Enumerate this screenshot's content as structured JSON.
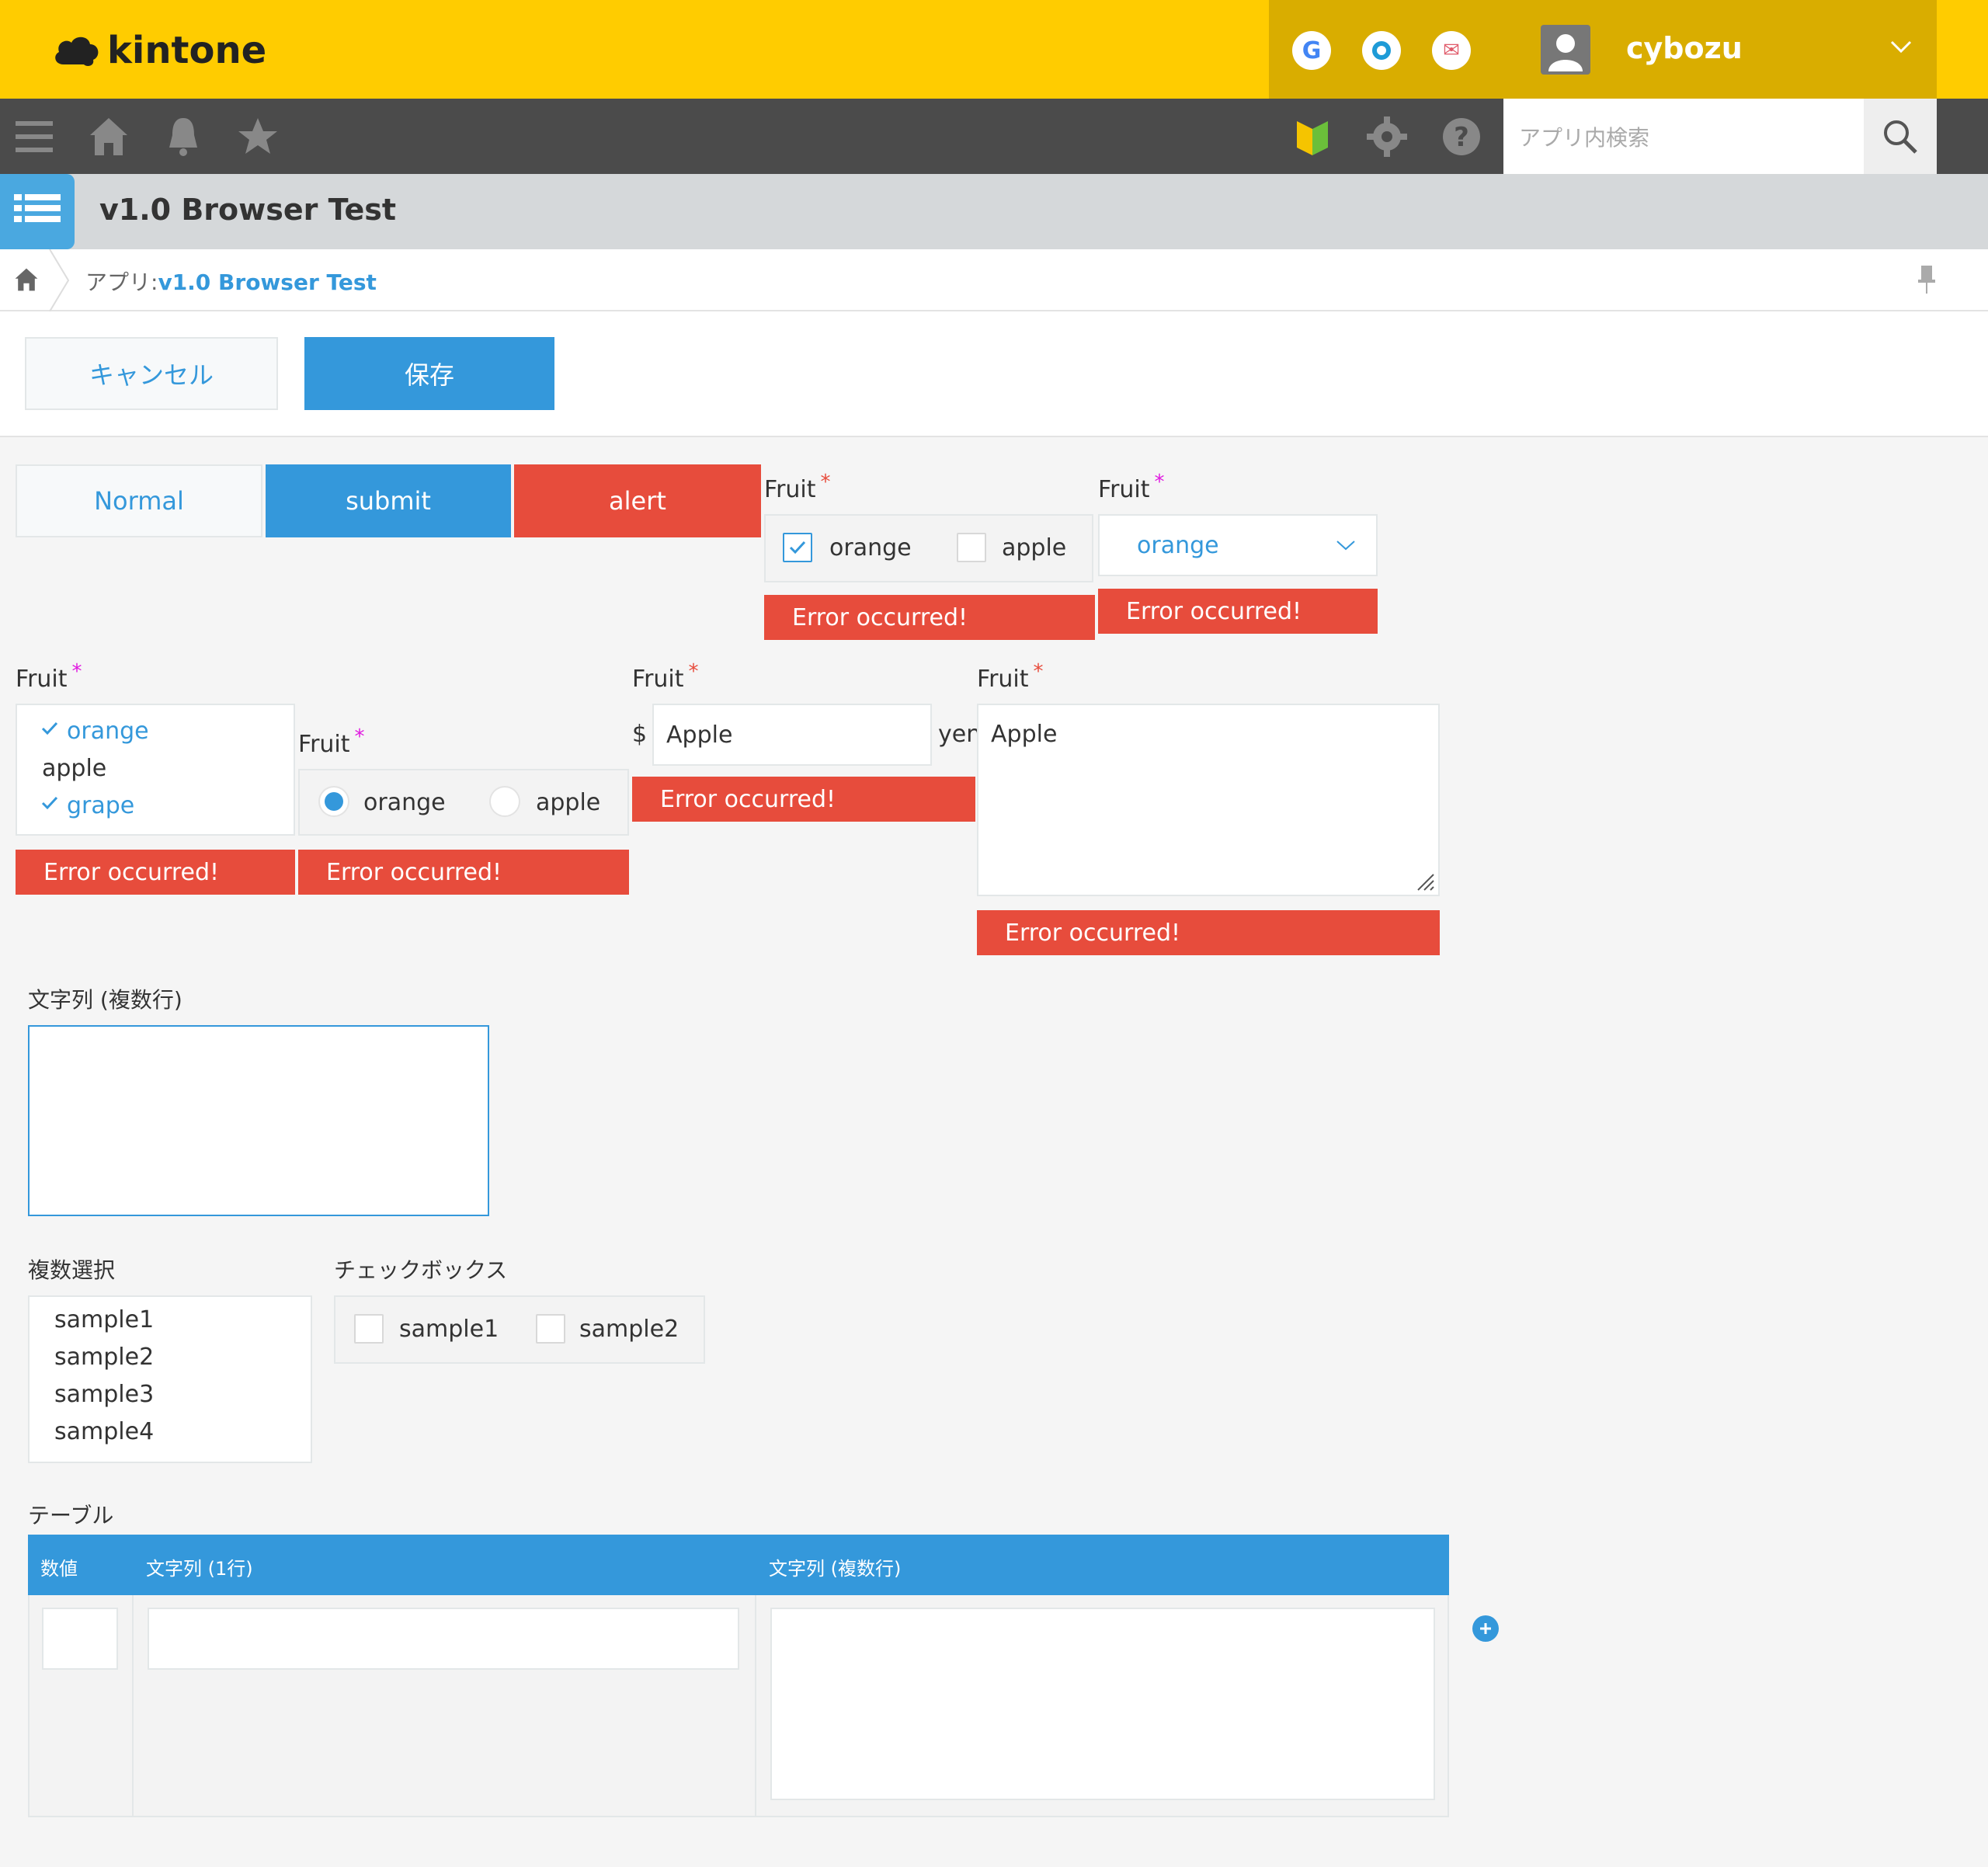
{
  "header": {
    "logo_text": "kintone",
    "apps": [
      {
        "name": "google-app",
        "glyph": "G",
        "color": "#4285f4"
      },
      {
        "name": "outlook-app",
        "glyph": "o",
        "color": "#1e9bd7"
      },
      {
        "name": "mail-app",
        "glyph": "✉",
        "color": "#e05a6a"
      }
    ],
    "username": "cybozu"
  },
  "nav": {
    "search_placeholder": "アプリ内検索"
  },
  "app": {
    "title": "v1.0 Browser Test",
    "breadcrumb_prefix": "アプリ:",
    "breadcrumb_app": "v1.0 Browser Test"
  },
  "actions": {
    "cancel": "キャンセル",
    "save": "保存"
  },
  "buttons": {
    "normal": "Normal",
    "submit": "submit",
    "alert": "alert"
  },
  "fields": {
    "label_fruit": "Fruit",
    "required_mark": "*",
    "error_text": "Error occurred!",
    "checkbox_options": [
      "orange",
      "apple"
    ],
    "dropdown_value": "orange",
    "multiselect_options": [
      "orange",
      "apple",
      "grape"
    ],
    "radio_options": [
      "orange",
      "apple"
    ],
    "currency_prefix": "$",
    "currency_value": "Apple",
    "currency_suffix": "yen",
    "textarea_value": "Apple"
  },
  "form": {
    "multiline_label": "文字列 (複数行)",
    "multichoice_label": "複数選択",
    "multichoice_options": [
      "sample1",
      "sample2",
      "sample3",
      "sample4"
    ],
    "checkbox_label": "チェックボックス",
    "checkbox_options": [
      "sample1",
      "sample2"
    ],
    "table_label": "テーブル",
    "table_columns": [
      "数値",
      "文字列 (1行)",
      "文字列 (複数行)"
    ]
  },
  "colors": {
    "header_yellow": "#ffcc00",
    "accent_blue": "#3498db",
    "error_red": "#e74c3c"
  }
}
